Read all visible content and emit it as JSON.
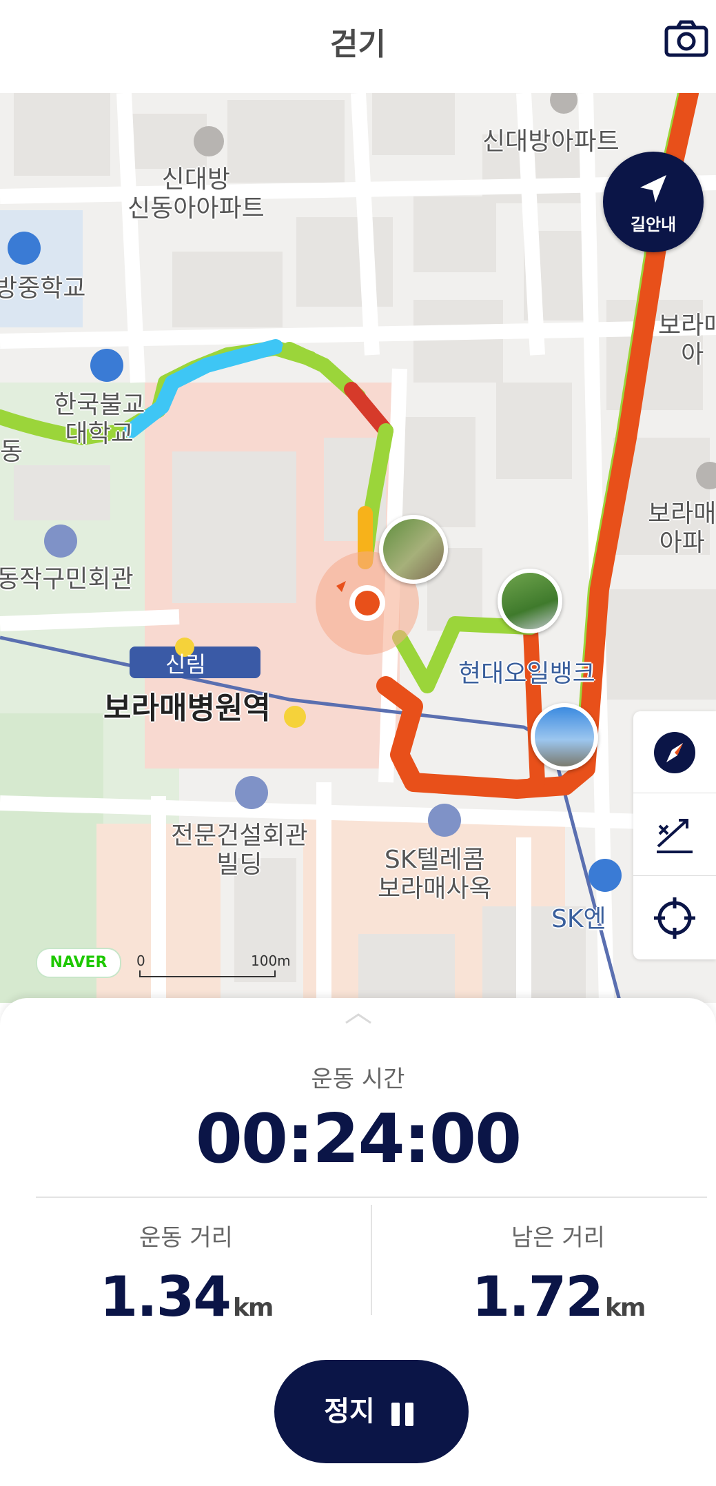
{
  "header": {
    "title": "걷기",
    "camera_icon": "camera-icon"
  },
  "map": {
    "labels": {
      "apt1": "신대방아파트",
      "apt2": "신대방\n신동아아파트",
      "school": "방중학교",
      "univ": "한국불교\n대학교",
      "dong": "동",
      "civic": "동작구민회관",
      "station": "보라매병원역",
      "line": "신림",
      "hyundai": "현대오일뱅크",
      "center": "전문건설회관\n빌딩",
      "sk": "SK텔레콤\n보라매사옥",
      "skgas": "SK엔",
      "borama1": "보라매\n아",
      "borama2": "보라매\n아파"
    },
    "nav_button_label": "길안내",
    "naver_logo": "NAVER",
    "scale": {
      "zero": "0",
      "distance": "100m"
    },
    "tools": [
      "compass-icon",
      "route-icon",
      "locate-icon"
    ]
  },
  "panel": {
    "time_label": "운동 시간",
    "time_value": "00:24:00",
    "distance_label": "운동 거리",
    "distance_value": "1.34",
    "distance_unit": "km",
    "remaining_label": "남은 거리",
    "remaining_value": "1.72",
    "remaining_unit": "km",
    "stop_label": "정지"
  },
  "colors": {
    "primary": "#0b1547",
    "route_orange": "#e8501a",
    "route_green": "#9bd53a",
    "route_blue": "#3ec6f5",
    "route_red": "#d63a2a"
  }
}
